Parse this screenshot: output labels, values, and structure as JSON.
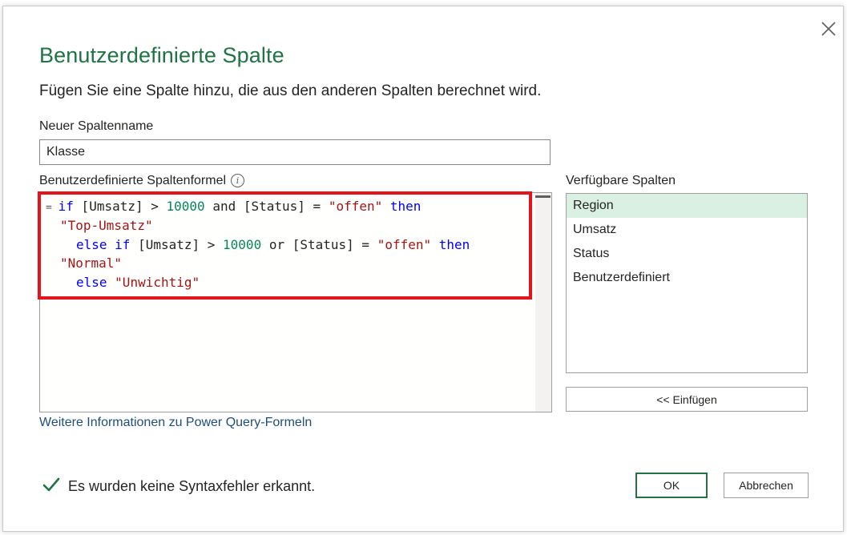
{
  "dialog": {
    "title": "Benutzerdefinierte Spalte",
    "subtitle": "Fügen Sie eine Spalte hinzu, die aus den anderen Spalten berechnet wird."
  },
  "column_name": {
    "label": "Neuer Spaltenname",
    "value": "Klasse"
  },
  "formula": {
    "label": "Benutzerdefinierte Spaltenformel",
    "info_icon": "i",
    "lines": [
      [
        {
          "t": "= ",
          "c": "eq"
        },
        {
          "t": "if",
          "c": "kw"
        },
        {
          "t": " [Umsatz] > ",
          "c": "plain"
        },
        {
          "t": "10000",
          "c": "num"
        },
        {
          "t": " and [Status] = ",
          "c": "plain"
        },
        {
          "t": "\"offen\"",
          "c": "str"
        },
        {
          "t": " ",
          "c": "plain"
        },
        {
          "t": "then",
          "c": "kw"
        }
      ],
      [
        {
          "t": "\"Top-Umsatz\"",
          "c": "str"
        }
      ],
      [
        {
          "t": "else",
          "c": "kw"
        },
        {
          "t": " ",
          "c": "plain"
        },
        {
          "t": "if",
          "c": "kw"
        },
        {
          "t": " [Umsatz] > ",
          "c": "plain"
        },
        {
          "t": "10000",
          "c": "num"
        },
        {
          "t": " or [Status] = ",
          "c": "plain"
        },
        {
          "t": "\"offen\"",
          "c": "str"
        },
        {
          "t": " ",
          "c": "plain"
        },
        {
          "t": "then",
          "c": "kw"
        }
      ],
      [
        {
          "t": "\"Normal\"",
          "c": "str"
        }
      ],
      [
        {
          "t": "else",
          "c": "kw"
        },
        {
          "t": " ",
          "c": "plain"
        },
        {
          "t": "\"Unwichtig\"",
          "c": "str"
        }
      ]
    ],
    "more_info_link": "Weitere Informationen zu Power Query-Formeln"
  },
  "available_columns": {
    "label": "Verfügbare Spalten",
    "items": [
      "Region",
      "Umsatz",
      "Status",
      "Benutzerdefiniert"
    ],
    "selected": "Region",
    "insert_button": "<< Einfügen"
  },
  "status": {
    "icon": "check-icon",
    "text": "Es wurden keine Syntaxfehler erkannt."
  },
  "buttons": {
    "ok": "OK",
    "cancel": "Abbrechen"
  },
  "colors": {
    "accent": "#217346",
    "highlight_border": "#e3151a",
    "selected_bg": "#d9f0e3",
    "keyword": "#0000ff",
    "number": "#098658",
    "string": "#a31515",
    "link": "#1f4e79"
  }
}
